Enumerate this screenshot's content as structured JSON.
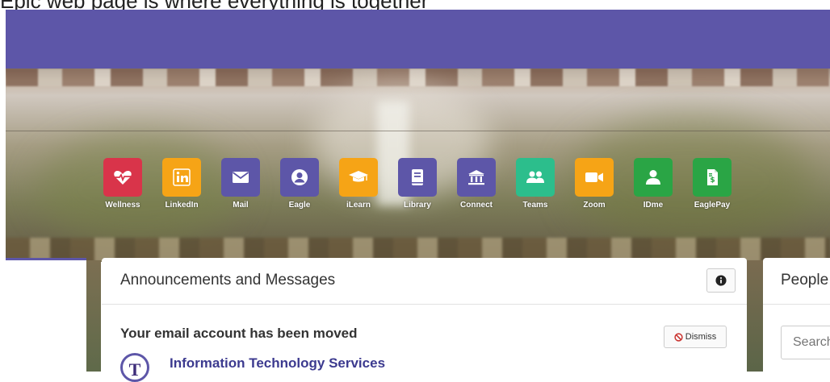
{
  "caption": "Epic web page is where everything is together",
  "quick_links": [
    {
      "label": "Wellness",
      "icon": "heartbeat-icon",
      "color": "#d9344a"
    },
    {
      "label": "LinkedIn",
      "icon": "linkedin-icon",
      "color": "#f6a416"
    },
    {
      "label": "Mail",
      "icon": "envelope-icon",
      "color": "#5d56a8"
    },
    {
      "label": "Eagle",
      "icon": "user-circle-icon",
      "color": "#5d56a8"
    },
    {
      "label": "iLearn",
      "icon": "graduation-cap-icon",
      "color": "#f6a416"
    },
    {
      "label": "Library",
      "icon": "book-icon",
      "color": "#5d56a8"
    },
    {
      "label": "Connect",
      "icon": "institution-icon",
      "color": "#5d56a8"
    },
    {
      "label": "Teams",
      "icon": "users-icon",
      "color": "#2cbe8c"
    },
    {
      "label": "Zoom",
      "icon": "video-camera-icon",
      "color": "#f6a416"
    },
    {
      "label": "IDme",
      "icon": "user-icon",
      "color": "#2aa545"
    },
    {
      "label": "EaglePay",
      "icon": "receipt-icon",
      "color": "#2aa545"
    }
  ],
  "announcements": {
    "title": "Announcements and Messages",
    "message_title": "Your email account has been moved",
    "dismiss_label": "Dismiss",
    "sender": "Information Technology Services",
    "logo_letter": "T"
  },
  "people": {
    "title": "People",
    "search_placeholder": "Search"
  },
  "colors": {
    "brand_purple": "#5d56a8",
    "link": "#3c3a8f"
  }
}
